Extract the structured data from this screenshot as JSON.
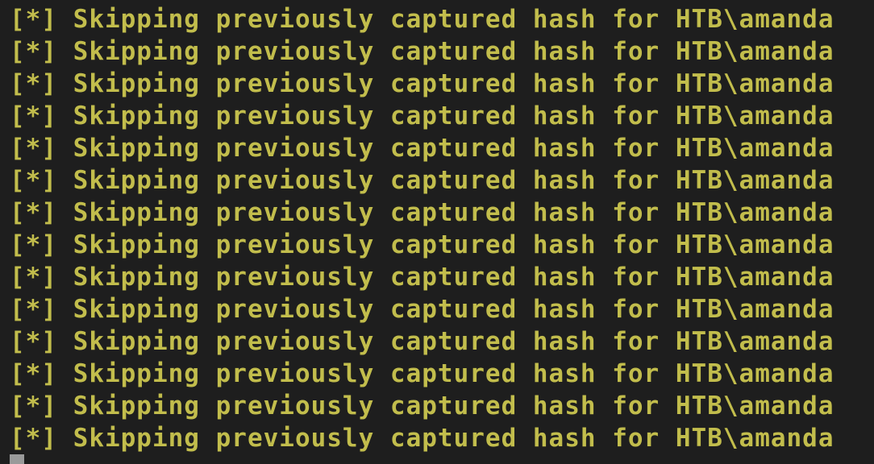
{
  "terminal": {
    "text_color": "#c2bd4c",
    "background_color": "#1e1e1e",
    "lines": [
      "[*] Skipping previously captured hash for HTB\\amanda",
      "[*] Skipping previously captured hash for HTB\\amanda",
      "[*] Skipping previously captured hash for HTB\\amanda",
      "[*] Skipping previously captured hash for HTB\\amanda",
      "[*] Skipping previously captured hash for HTB\\amanda",
      "[*] Skipping previously captured hash for HTB\\amanda",
      "[*] Skipping previously captured hash for HTB\\amanda",
      "[*] Skipping previously captured hash for HTB\\amanda",
      "[*] Skipping previously captured hash for HTB\\amanda",
      "[*] Skipping previously captured hash for HTB\\amanda",
      "[*] Skipping previously captured hash for HTB\\amanda",
      "[*] Skipping previously captured hash for HTB\\amanda",
      "[*] Skipping previously captured hash for HTB\\amanda",
      "[*] Skipping previously captured hash for HTB\\amanda"
    ]
  }
}
